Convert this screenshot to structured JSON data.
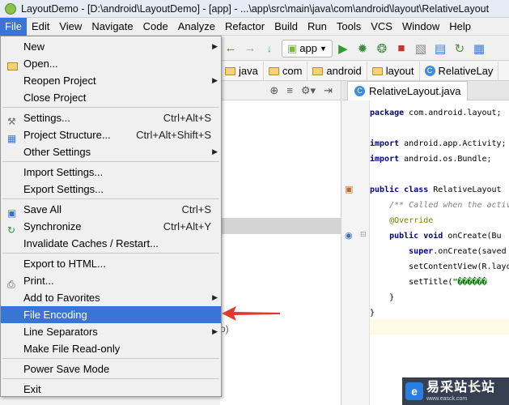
{
  "window": {
    "title": "LayoutDemo - [D:\\android\\LayoutDemo] - [app] - ...\\app\\src\\main\\java\\com\\android\\layout\\RelativeLayout"
  },
  "menubar": [
    "File",
    "Edit",
    "View",
    "Navigate",
    "Code",
    "Analyze",
    "Refactor",
    "Build",
    "Run",
    "Tools",
    "VCS",
    "Window",
    "Help"
  ],
  "toolbar": {
    "run_config": "app"
  },
  "breadcrumb": [
    "java",
    "com",
    "android",
    "layout",
    "RelativeLay"
  ],
  "editor": {
    "tab_label": "RelativeLayout.java",
    "lines": [
      {
        "parts": [
          [
            "kw",
            "package"
          ],
          [
            "fn",
            " com.android.layout;"
          ]
        ]
      },
      {
        "parts": []
      },
      {
        "parts": [
          [
            "kw",
            "import"
          ],
          [
            "fn",
            " android.app.Activity;"
          ]
        ]
      },
      {
        "parts": [
          [
            "kw",
            "import"
          ],
          [
            "fn",
            " android.os.Bundle;"
          ]
        ]
      },
      {
        "parts": []
      },
      {
        "parts": [
          [
            "kw",
            "public class"
          ],
          [
            "fn",
            " RelativeLayout"
          ]
        ]
      },
      {
        "parts": [
          [
            "cm",
            "    /** Called when the activ"
          ]
        ]
      },
      {
        "parts": [
          [
            "an",
            "    @Override"
          ]
        ]
      },
      {
        "parts": [
          [
            "kw",
            "    public void"
          ],
          [
            "fn",
            " onCreate(Bu"
          ]
        ]
      },
      {
        "parts": [
          [
            "kw",
            "        super"
          ],
          [
            "fn",
            ".onCreate(saved"
          ]
        ]
      },
      {
        "parts": [
          [
            "fn",
            "        setContentView(R.layo"
          ]
        ]
      },
      {
        "parts": [
          [
            "fn",
            "        setTitle("
          ],
          [
            "str",
            "\"������"
          ]
        ]
      },
      {
        "parts": [
          [
            "fn",
            "    }"
          ]
        ]
      },
      {
        "parts": [
          [
            "fn",
            "}"
          ]
        ]
      }
    ]
  },
  "left_panel": {
    "fragment": "o)"
  },
  "file_menu": {
    "items": [
      {
        "label": "New",
        "shortcut": "",
        "submenu": true,
        "icon": "",
        "mnemonic": "N"
      },
      {
        "label": "Open...",
        "shortcut": "",
        "submenu": false,
        "icon": "folder-open-icon",
        "mnemonic": "O"
      },
      {
        "label": "Reopen Project",
        "shortcut": "",
        "submenu": true,
        "icon": "",
        "mnemonic": "R"
      },
      {
        "label": "Close Project",
        "shortcut": "",
        "submenu": false,
        "icon": "",
        "mnemonic": ""
      },
      {
        "sep": true
      },
      {
        "label": "Settings...",
        "shortcut": "Ctrl+Alt+S",
        "submenu": false,
        "icon": "settings-wrench-icon",
        "mnemonic": "t"
      },
      {
        "label": "Project Structure...",
        "shortcut": "Ctrl+Alt+Shift+S",
        "submenu": false,
        "icon": "project-structure-icon",
        "mnemonic": ""
      },
      {
        "label": "Other Settings",
        "shortcut": "",
        "submenu": true,
        "icon": "",
        "mnemonic": ""
      },
      {
        "sep": true
      },
      {
        "label": "Import Settings...",
        "shortcut": "",
        "submenu": false,
        "icon": "",
        "mnemonic": ""
      },
      {
        "label": "Export Settings...",
        "shortcut": "",
        "submenu": false,
        "icon": "",
        "mnemonic": "E"
      },
      {
        "sep": true
      },
      {
        "label": "Save All",
        "shortcut": "Ctrl+S",
        "submenu": false,
        "icon": "save-all-icon",
        "mnemonic": "S"
      },
      {
        "label": "Synchronize",
        "shortcut": "Ctrl+Alt+Y",
        "submenu": false,
        "icon": "synchronize-icon",
        "mnemonic": "y"
      },
      {
        "label": "Invalidate Caches / Restart...",
        "shortcut": "",
        "submenu": false,
        "icon": "",
        "mnemonic": ""
      },
      {
        "sep": true
      },
      {
        "label": "Export to HTML...",
        "shortcut": "",
        "submenu": false,
        "icon": "",
        "mnemonic": "H"
      },
      {
        "label": "Print...",
        "shortcut": "",
        "submenu": false,
        "icon": "print-icon",
        "mnemonic": "P"
      },
      {
        "label": "Add to Favorites",
        "shortcut": "",
        "submenu": true,
        "icon": "",
        "mnemonic": "F"
      },
      {
        "label": "File Encoding",
        "shortcut": "",
        "submenu": false,
        "icon": "",
        "mnemonic": "",
        "selected": true
      },
      {
        "label": "Line Separators",
        "shortcut": "",
        "submenu": true,
        "icon": "",
        "mnemonic": ""
      },
      {
        "label": "Make File Read-only",
        "shortcut": "",
        "submenu": false,
        "icon": "",
        "mnemonic": ""
      },
      {
        "sep": true
      },
      {
        "label": "Power Save Mode",
        "shortcut": "",
        "submenu": false,
        "icon": "",
        "mnemonic": ""
      },
      {
        "sep": true
      },
      {
        "label": "Exit",
        "shortcut": "",
        "submenu": false,
        "icon": "",
        "mnemonic": "x"
      }
    ]
  },
  "watermark": {
    "name": "易采站长站",
    "url": "www.easck.com"
  },
  "colors": {
    "menu_selected": "#3875d7",
    "annotation_arrow": "#e03a2e"
  }
}
